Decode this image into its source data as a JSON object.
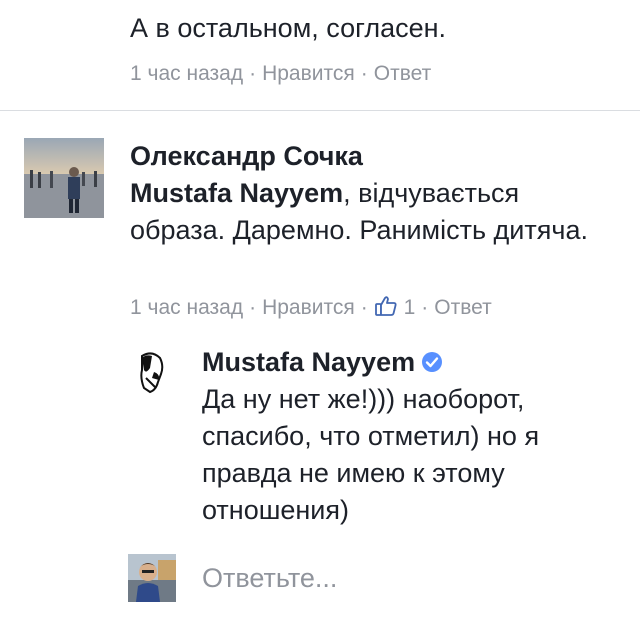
{
  "previous_comment": {
    "text": "А в остальном, согласен.",
    "time": "1 час назад",
    "like_label": "Нравится",
    "reply_label": "Ответ"
  },
  "comment": {
    "author": "Олександр Сочка",
    "mention": "Mustafa Nayyem",
    "text": ", відчувається образа. Даремно. Ранимість дитяча.",
    "time": "1 час назад",
    "like_label": "Нравится",
    "like_count": "1",
    "reply_label": "Ответ",
    "avatar_icon": "user-photo"
  },
  "reply": {
    "author": "Mustafa Nayyem",
    "verified_icon": "verified-badge-icon",
    "text": "Да ну нет же!))) наоборот, спасибо, что отметил) но я правда не имею к этому отношения)",
    "avatar_icon": "user-photo"
  },
  "composer": {
    "placeholder": "Ответьте...",
    "avatar_icon": "user-photo"
  },
  "colors": {
    "text": "#1d2129",
    "meta": "#90949c",
    "accent": "#4267b2",
    "verified": "#5890ff"
  }
}
